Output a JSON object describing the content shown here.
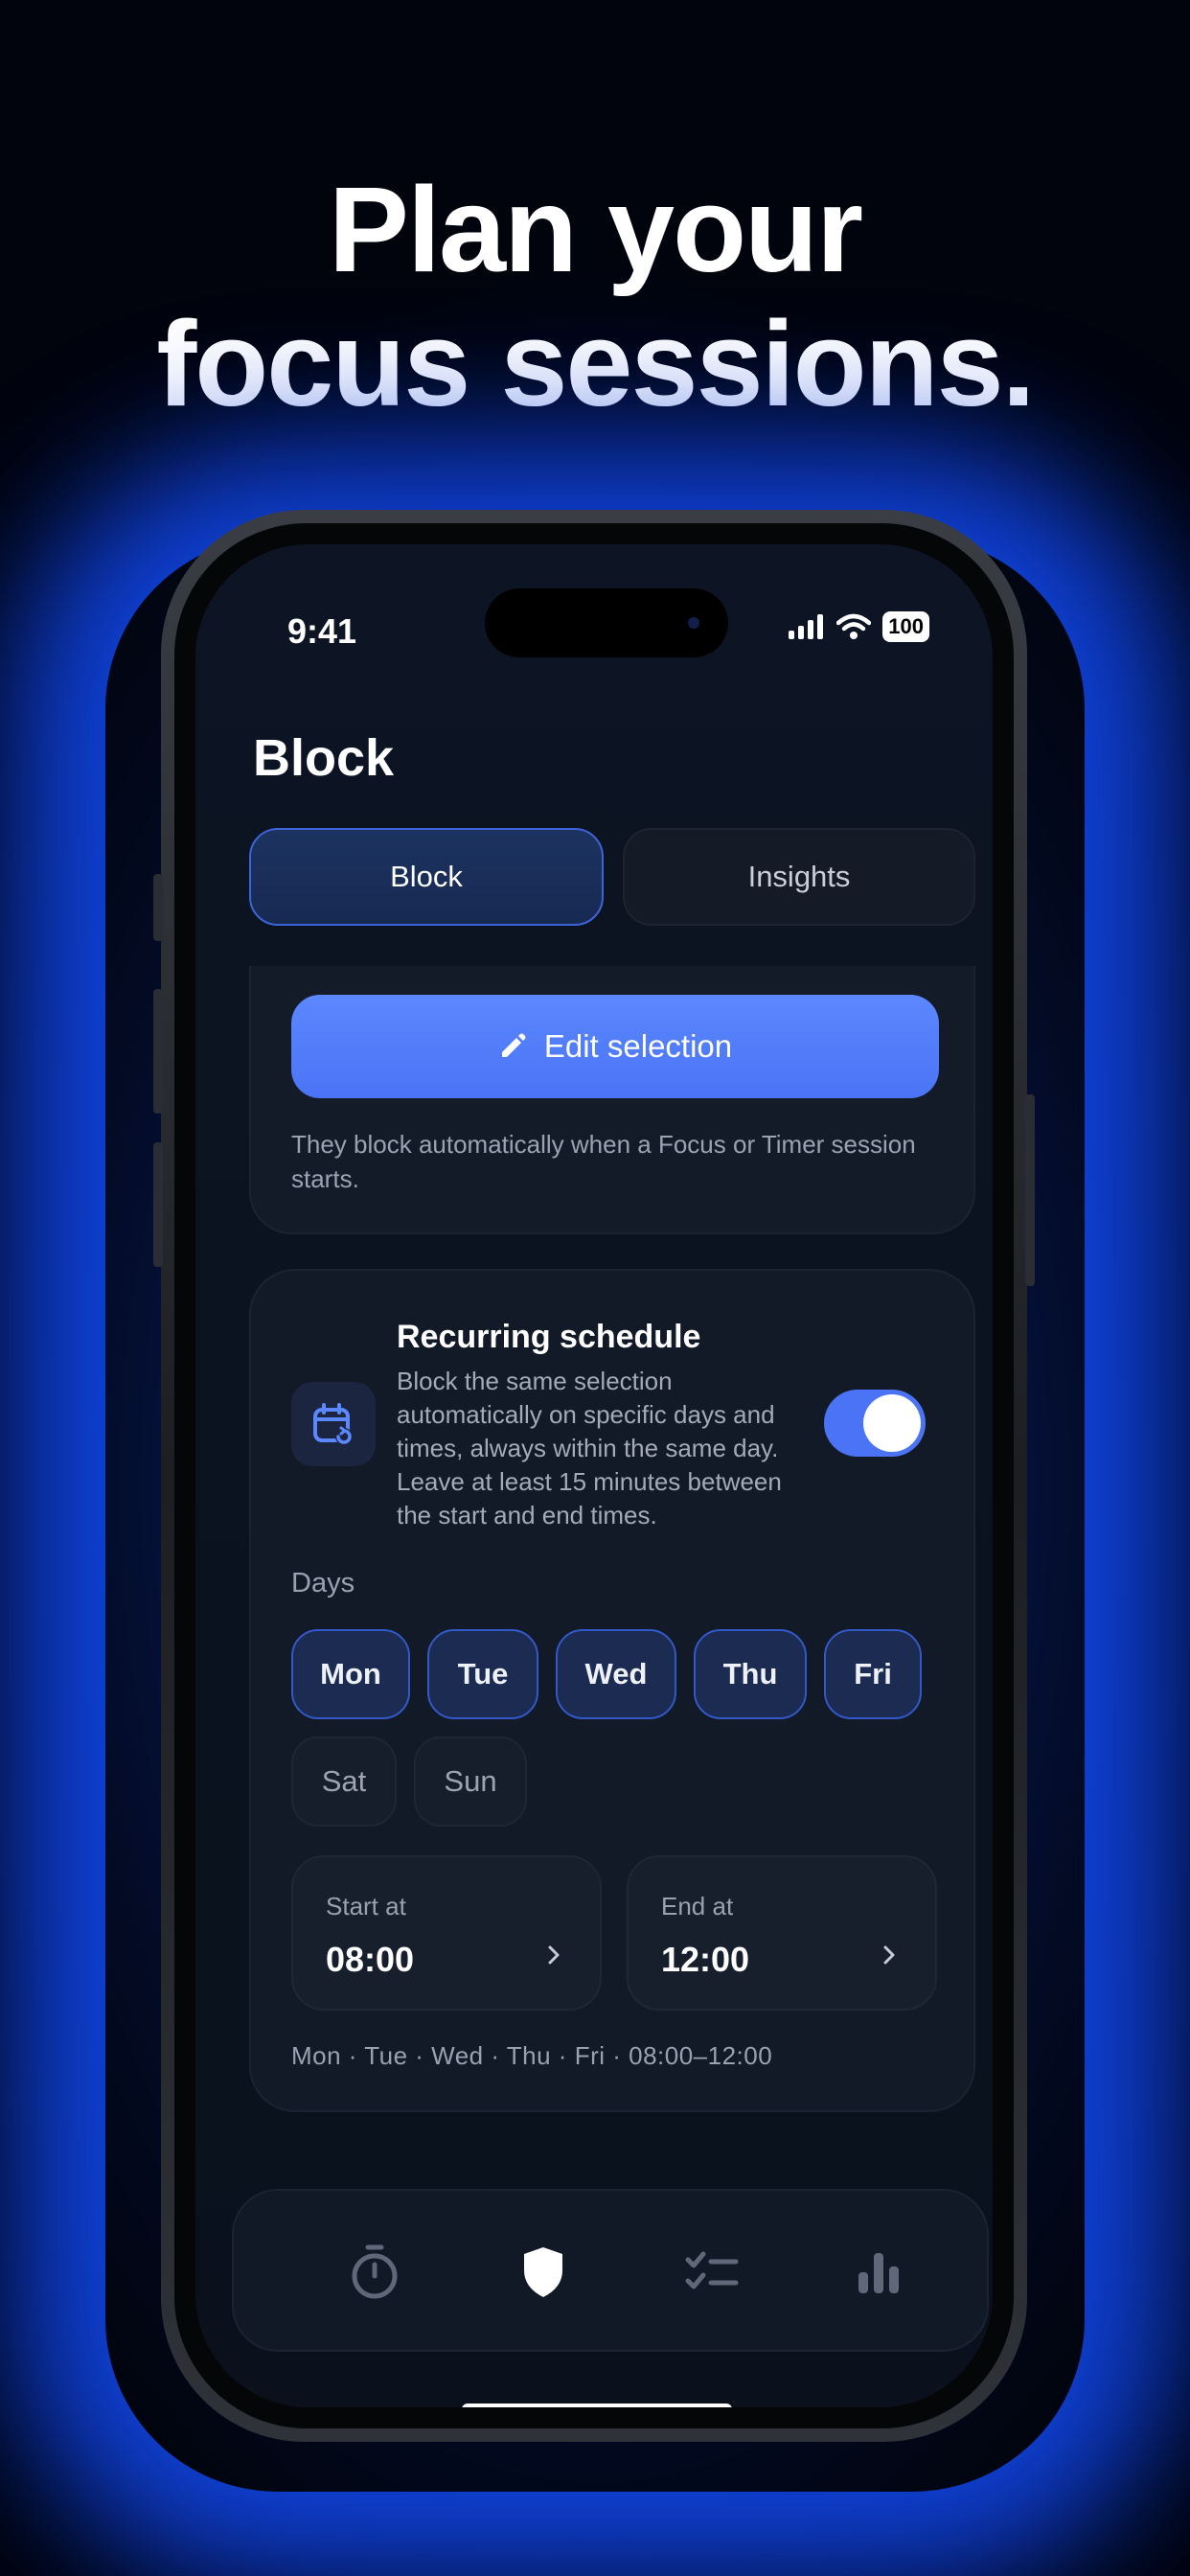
{
  "headline": {
    "line1": "Plan your",
    "line2": "focus sessions."
  },
  "status_bar": {
    "time": "9:41",
    "battery": "100"
  },
  "screen": {
    "title": "Block",
    "segments": [
      {
        "label": "Block",
        "selected": true
      },
      {
        "label": "Insights",
        "selected": false
      }
    ],
    "edit_button": {
      "label": "Edit selection",
      "icon": "pencil-icon"
    },
    "selection_note": "They block automatically when a Focus or Timer session starts.",
    "schedule": {
      "title": "Recurring schedule",
      "description": "Block the same selection automatically on specific days and times, always within the same day. Leave at least 15 minutes between the start and end times.",
      "enabled": true,
      "days_label": "Days",
      "days": [
        {
          "label": "Mon",
          "selected": true
        },
        {
          "label": "Tue",
          "selected": true
        },
        {
          "label": "Wed",
          "selected": true
        },
        {
          "label": "Thu",
          "selected": true
        },
        {
          "label": "Fri",
          "selected": true
        },
        {
          "label": "Sat",
          "selected": false
        },
        {
          "label": "Sun",
          "selected": false
        }
      ],
      "start": {
        "label": "Start at",
        "value": "08:00"
      },
      "end": {
        "label": "End at",
        "value": "12:00"
      },
      "summary": "Mon · Tue · Wed · Thu · Fri · 08:00–12:00"
    },
    "tab_bar": [
      {
        "icon": "timer-icon",
        "active": false
      },
      {
        "icon": "shield-icon",
        "active": true
      },
      {
        "icon": "checklist-icon",
        "active": false
      },
      {
        "icon": "bar-chart-icon",
        "active": false
      }
    ]
  },
  "colors": {
    "accent": "#4a74f5",
    "background": "#0b1320",
    "glow": "#1450ff"
  }
}
